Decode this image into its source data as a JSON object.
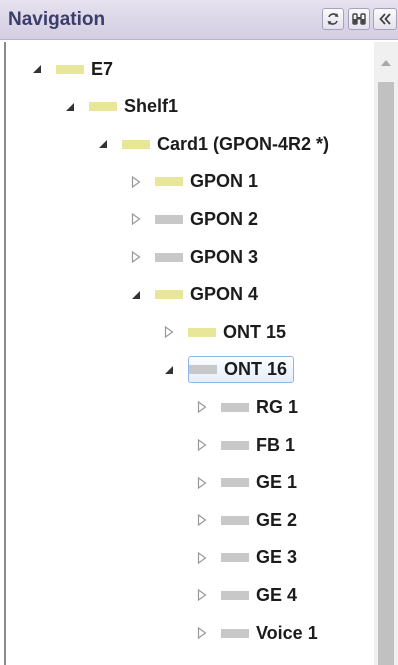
{
  "panel": {
    "title": "Navigation"
  },
  "toolbar": [
    {
      "name": "refresh-icon"
    },
    {
      "name": "find-icon"
    },
    {
      "name": "collapse-panel-icon"
    }
  ],
  "tree": [
    {
      "label": "E7",
      "level": 0,
      "expanded": true,
      "color": "yellow"
    },
    {
      "label": "Shelf1",
      "level": 1,
      "expanded": true,
      "color": "yellow"
    },
    {
      "label": "Card1 (GPON-4R2 *)",
      "level": 2,
      "expanded": true,
      "color": "yellow"
    },
    {
      "label": "GPON 1",
      "level": 3,
      "expanded": false,
      "color": "yellow"
    },
    {
      "label": "GPON 2",
      "level": 3,
      "expanded": false,
      "color": "gray"
    },
    {
      "label": "GPON 3",
      "level": 3,
      "expanded": false,
      "color": "gray"
    },
    {
      "label": "GPON 4",
      "level": 3,
      "expanded": true,
      "color": "yellow"
    },
    {
      "label": "ONT 15",
      "level": 4,
      "expanded": false,
      "color": "yellow"
    },
    {
      "label": "ONT 16",
      "level": 4,
      "expanded": true,
      "color": "gray",
      "selected": true
    },
    {
      "label": "RG 1",
      "level": 5,
      "expanded": false,
      "color": "gray"
    },
    {
      "label": "FB 1",
      "level": 5,
      "expanded": false,
      "color": "gray"
    },
    {
      "label": "GE 1",
      "level": 5,
      "expanded": false,
      "color": "gray"
    },
    {
      "label": "GE 2",
      "level": 5,
      "expanded": false,
      "color": "gray"
    },
    {
      "label": "GE 3",
      "level": 5,
      "expanded": false,
      "color": "gray"
    },
    {
      "label": "GE 4",
      "level": 5,
      "expanded": false,
      "color": "gray"
    },
    {
      "label": "Voice 1",
      "level": 5,
      "expanded": false,
      "color": "gray"
    }
  ]
}
